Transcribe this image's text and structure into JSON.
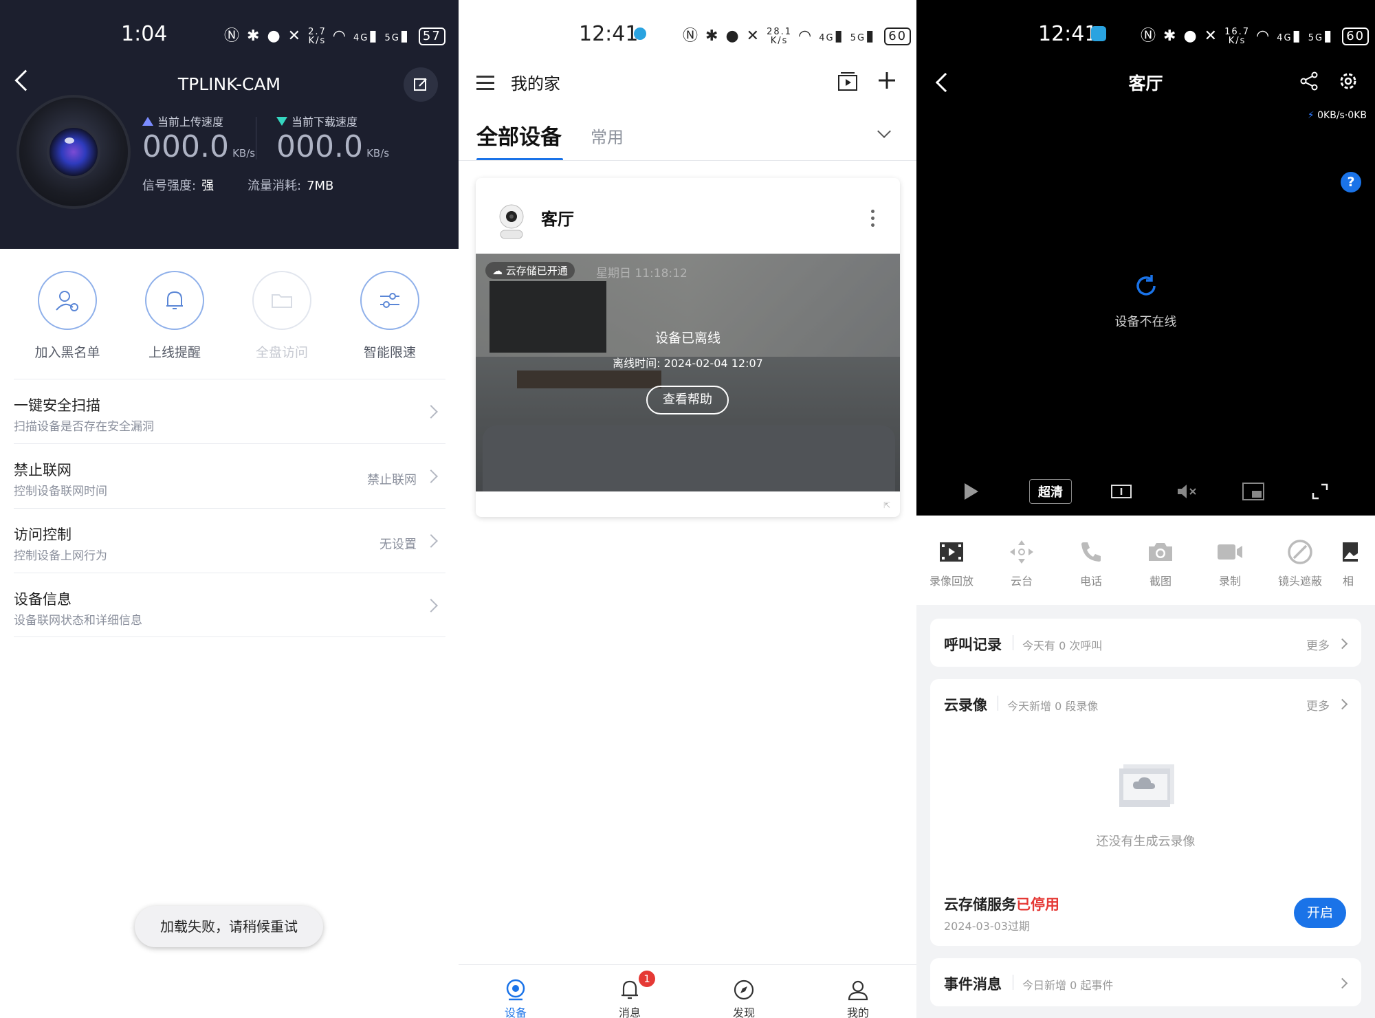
{
  "panel1": {
    "status": {
      "time": "1:04",
      "rate_top": "2.7",
      "rate_bottom": "K/s",
      "battery": "57",
      "signal1": "4G",
      "signal2": "5G"
    },
    "header": {
      "title": "TPLINK-CAM"
    },
    "upload": {
      "label": "当前上传速度",
      "value": "000.0",
      "unit": "KB/s"
    },
    "download": {
      "label": "当前下载速度",
      "value": "000.0",
      "unit": "KB/s"
    },
    "signal": {
      "label": "信号强度:",
      "value": "强"
    },
    "traffic": {
      "label": "流量消耗:",
      "value": "7MB"
    },
    "quick_actions": [
      {
        "label": "加入黑名单",
        "icon": "user-block-icon",
        "enabled": true
      },
      {
        "label": "上线提醒",
        "icon": "bell-icon",
        "enabled": true
      },
      {
        "label": "全盘访问",
        "icon": "folder-icon",
        "enabled": false
      },
      {
        "label": "智能限速",
        "icon": "sliders-icon",
        "enabled": true
      }
    ],
    "menu": [
      {
        "title": "一键安全扫描",
        "sub": "扫描设备是否存在安全漏洞",
        "value": ""
      },
      {
        "title": "禁止联网",
        "sub": "控制设备联网时间",
        "value": "禁止联网"
      },
      {
        "title": "访问控制",
        "sub": "控制设备上网行为",
        "value": "无设置"
      },
      {
        "title": "设备信息",
        "sub": "设备联网状态和详细信息",
        "value": ""
      }
    ],
    "toast": "加载失败，请稍候重试"
  },
  "panel2": {
    "status": {
      "time": "12:41",
      "rate_top": "28.1",
      "rate_bottom": "K/s",
      "battery": "60",
      "signal1": "4G",
      "signal2": "5G"
    },
    "home_title": "我的家",
    "tabs": {
      "active": "全部设备",
      "other": "常用"
    },
    "device": {
      "name": "客厅",
      "cloud_badge": "云存储已开通",
      "preview_date": "星期日  11:18:12",
      "offline_title": "设备已离线",
      "offline_time": "离线时间: 2024-02-04 12:07",
      "help_button": "查看帮助"
    },
    "nav": [
      {
        "label": "设备",
        "icon": "device-icon",
        "active": true
      },
      {
        "label": "消息",
        "icon": "bell-icon",
        "active": false,
        "badge": "1"
      },
      {
        "label": "发现",
        "icon": "compass-icon",
        "active": false
      },
      {
        "label": "我的",
        "icon": "user-icon",
        "active": false
      }
    ]
  },
  "panel3": {
    "status": {
      "time": "12:41",
      "rate_top": "16.7",
      "rate_bottom": "K/s",
      "battery": "60",
      "signal1": "4G",
      "signal2": "5G"
    },
    "title": "客厅",
    "stream_rate": "0KB/s·0KB",
    "help": "?",
    "offline_text": "设备不在线",
    "quality": "超清",
    "functions": [
      {
        "label": "录像回放",
        "icon": "film-icon"
      },
      {
        "label": "云台",
        "icon": "ptz-icon"
      },
      {
        "label": "电话",
        "icon": "phone-icon"
      },
      {
        "label": "截图",
        "icon": "camera-icon"
      },
      {
        "label": "录制",
        "icon": "video-icon"
      },
      {
        "label": "镜头遮蔽",
        "icon": "block-icon"
      },
      {
        "label": "相",
        "icon": "image-icon"
      }
    ],
    "call_log": {
      "title": "呼叫记录",
      "sub": "今天有 0 次呼叫",
      "more": "更多"
    },
    "cloud_video": {
      "title": "云录像",
      "sub": "今天新增 0 段录像",
      "more": "更多",
      "empty": "还没有生成云录像",
      "service_label": "云存储服务",
      "service_status": "已停用",
      "expire": "2024-03-03过期",
      "open_button": "开启"
    },
    "events": {
      "title": "事件消息",
      "sub": "今日新增 0 起事件"
    }
  },
  "colors": {
    "accent": "#1a73e8",
    "header_dark": "#1c1f2e",
    "danger": "#e53935"
  }
}
